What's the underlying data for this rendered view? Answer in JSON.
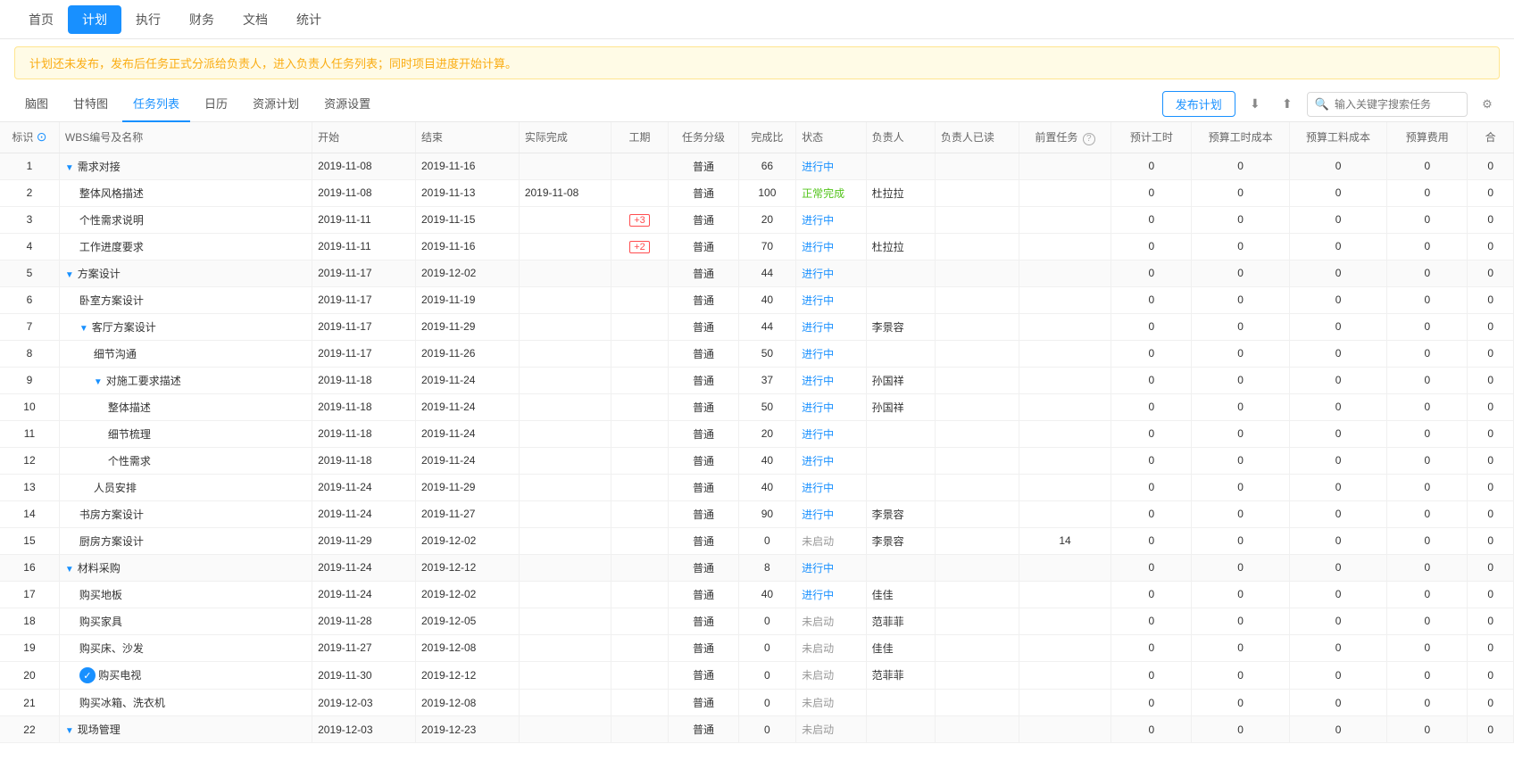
{
  "topNav": {
    "items": [
      {
        "label": "首页",
        "active": false
      },
      {
        "label": "计划",
        "active": true
      },
      {
        "label": "执行",
        "active": false
      },
      {
        "label": "财务",
        "active": false
      },
      {
        "label": "文档",
        "active": false
      },
      {
        "label": "统计",
        "active": false
      }
    ]
  },
  "alert": {
    "text": "计划还未发布，发布后任务正式分派给负责人，进入负责人任务列表；同时项目进度开始计算。"
  },
  "subNav": {
    "items": [
      {
        "label": "脑图",
        "active": false
      },
      {
        "label": "甘特图",
        "active": false
      },
      {
        "label": "任务列表",
        "active": true
      },
      {
        "label": "日历",
        "active": false
      },
      {
        "label": "资源计划",
        "active": false
      },
      {
        "label": "资源设置",
        "active": false
      }
    ],
    "publishBtn": "发布计划",
    "searchPlaceholder": "输入关键字搜索任务"
  },
  "table": {
    "columns": [
      "标识",
      "WBS编号及名称",
      "开始",
      "结束",
      "实际完成",
      "工期",
      "任务分级",
      "完成比",
      "状态",
      "负责人",
      "负责人已读",
      "前置任务",
      "预计工时",
      "预算工时成本",
      "预算工料成本",
      "预算费用",
      "合"
    ],
    "rows": [
      {
        "id": "1",
        "level": 0,
        "isGroup": true,
        "expand": true,
        "name": "需求对接",
        "start": "2019-11-08",
        "end": "2019-11-16",
        "actual": "",
        "work": "",
        "priority": "普通",
        "progress": "66",
        "status": "进行中",
        "assignee": "",
        "read": "",
        "predecessor": "",
        "estTime": "0",
        "estTimeCost": "0",
        "estLaborCost": "0",
        "estExpense": "0"
      },
      {
        "id": "2",
        "level": 1,
        "isGroup": false,
        "name": "整体风格描述",
        "start": "2019-11-08",
        "end": "2019-11-13",
        "actual": "2019-11-08",
        "work": "",
        "priority": "普通",
        "progress": "100",
        "status": "正常完成",
        "assignee": "杜拉拉",
        "read": "",
        "predecessor": "",
        "estTime": "0",
        "estTimeCost": "0",
        "estLaborCost": "0",
        "estExpense": "0"
      },
      {
        "id": "3",
        "level": 1,
        "isGroup": false,
        "name": "个性需求说明",
        "start": "2019-11-11",
        "end": "2019-11-15",
        "actual": "",
        "work": "+3",
        "priority": "普通",
        "progress": "20",
        "status": "进行中",
        "assignee": "",
        "read": "",
        "predecessor": "",
        "estTime": "0",
        "estTimeCost": "0",
        "estLaborCost": "0",
        "estExpense": "0"
      },
      {
        "id": "4",
        "level": 1,
        "isGroup": false,
        "name": "工作进度要求",
        "start": "2019-11-11",
        "end": "2019-11-16",
        "actual": "",
        "work": "+2",
        "priority": "普通",
        "progress": "70",
        "status": "进行中",
        "assignee": "杜拉拉",
        "read": "",
        "predecessor": "",
        "estTime": "0",
        "estTimeCost": "0",
        "estLaborCost": "0",
        "estExpense": "0"
      },
      {
        "id": "5",
        "level": 0,
        "isGroup": true,
        "expand": true,
        "name": "方案设计",
        "start": "2019-11-17",
        "end": "2019-12-02",
        "actual": "",
        "work": "",
        "priority": "普通",
        "progress": "44",
        "status": "进行中",
        "assignee": "",
        "read": "",
        "predecessor": "",
        "estTime": "0",
        "estTimeCost": "0",
        "estLaborCost": "0",
        "estExpense": "0"
      },
      {
        "id": "6",
        "level": 1,
        "isGroup": false,
        "name": "卧室方案设计",
        "start": "2019-11-17",
        "end": "2019-11-19",
        "actual": "",
        "work": "",
        "priority": "普通",
        "progress": "40",
        "status": "进行中",
        "assignee": "",
        "read": "",
        "predecessor": "",
        "estTime": "0",
        "estTimeCost": "0",
        "estLaborCost": "0",
        "estExpense": "0"
      },
      {
        "id": "7",
        "level": 1,
        "isGroup": true,
        "expand": true,
        "name": "客厅方案设计",
        "start": "2019-11-17",
        "end": "2019-11-29",
        "actual": "",
        "work": "",
        "priority": "普通",
        "progress": "44",
        "status": "进行中",
        "assignee": "李景容",
        "read": "",
        "predecessor": "",
        "estTime": "0",
        "estTimeCost": "0",
        "estLaborCost": "0",
        "estExpense": "0"
      },
      {
        "id": "8",
        "level": 2,
        "isGroup": false,
        "name": "细节沟通",
        "start": "2019-11-17",
        "end": "2019-11-26",
        "actual": "",
        "work": "",
        "priority": "普通",
        "progress": "50",
        "status": "进行中",
        "assignee": "",
        "read": "",
        "predecessor": "",
        "estTime": "0",
        "estTimeCost": "0",
        "estLaborCost": "0",
        "estExpense": "0"
      },
      {
        "id": "9",
        "level": 2,
        "isGroup": true,
        "expand": true,
        "name": "对施工要求描述",
        "start": "2019-11-18",
        "end": "2019-11-24",
        "actual": "",
        "work": "",
        "priority": "普通",
        "progress": "37",
        "status": "进行中",
        "assignee": "孙国祥",
        "read": "",
        "predecessor": "",
        "estTime": "0",
        "estTimeCost": "0",
        "estLaborCost": "0",
        "estExpense": "0"
      },
      {
        "id": "10",
        "level": 3,
        "isGroup": false,
        "name": "整体描述",
        "start": "2019-11-18",
        "end": "2019-11-24",
        "actual": "",
        "work": "",
        "priority": "普通",
        "progress": "50",
        "status": "进行中",
        "assignee": "孙国祥",
        "read": "",
        "predecessor": "",
        "estTime": "0",
        "estTimeCost": "0",
        "estLaborCost": "0",
        "estExpense": "0"
      },
      {
        "id": "11",
        "level": 3,
        "isGroup": false,
        "name": "细节梳理",
        "start": "2019-11-18",
        "end": "2019-11-24",
        "actual": "",
        "work": "",
        "priority": "普通",
        "progress": "20",
        "status": "进行中",
        "assignee": "",
        "read": "",
        "predecessor": "",
        "estTime": "0",
        "estTimeCost": "0",
        "estLaborCost": "0",
        "estExpense": "0"
      },
      {
        "id": "12",
        "level": 3,
        "isGroup": false,
        "name": "个性需求",
        "start": "2019-11-18",
        "end": "2019-11-24",
        "actual": "",
        "work": "",
        "priority": "普通",
        "progress": "40",
        "status": "进行中",
        "assignee": "",
        "read": "",
        "predecessor": "",
        "estTime": "0",
        "estTimeCost": "0",
        "estLaborCost": "0",
        "estExpense": "0"
      },
      {
        "id": "13",
        "level": 2,
        "isGroup": false,
        "name": "人员安排",
        "start": "2019-11-24",
        "end": "2019-11-29",
        "actual": "",
        "work": "",
        "priority": "普通",
        "progress": "40",
        "status": "进行中",
        "assignee": "",
        "read": "",
        "predecessor": "",
        "estTime": "0",
        "estTimeCost": "0",
        "estLaborCost": "0",
        "estExpense": "0"
      },
      {
        "id": "14",
        "level": 1,
        "isGroup": false,
        "name": "书房方案设计",
        "start": "2019-11-24",
        "end": "2019-11-27",
        "actual": "",
        "work": "",
        "priority": "普通",
        "progress": "90",
        "status": "进行中",
        "assignee": "李景容",
        "read": "",
        "predecessor": "",
        "estTime": "0",
        "estTimeCost": "0",
        "estLaborCost": "0",
        "estExpense": "0"
      },
      {
        "id": "15",
        "level": 1,
        "isGroup": false,
        "name": "厨房方案设计",
        "start": "2019-11-29",
        "end": "2019-12-02",
        "actual": "",
        "work": "",
        "priority": "普通",
        "progress": "0",
        "status": "未启动",
        "assignee": "李景容",
        "read": "",
        "predecessor": "14",
        "estTime": "0",
        "estTimeCost": "0",
        "estLaborCost": "0",
        "estExpense": "0"
      },
      {
        "id": "16",
        "level": 0,
        "isGroup": true,
        "expand": true,
        "name": "材料采购",
        "start": "2019-11-24",
        "end": "2019-12-12",
        "actual": "",
        "work": "",
        "priority": "普通",
        "progress": "8",
        "status": "进行中",
        "assignee": "",
        "read": "",
        "predecessor": "",
        "estTime": "0",
        "estTimeCost": "0",
        "estLaborCost": "0",
        "estExpense": "0"
      },
      {
        "id": "17",
        "level": 1,
        "isGroup": false,
        "name": "购买地板",
        "start": "2019-11-24",
        "end": "2019-12-02",
        "actual": "",
        "work": "",
        "priority": "普通",
        "progress": "40",
        "status": "进行中",
        "assignee": "佳佳",
        "read": "",
        "predecessor": "",
        "estTime": "0",
        "estTimeCost": "0",
        "estLaborCost": "0",
        "estExpense": "0"
      },
      {
        "id": "18",
        "level": 1,
        "isGroup": false,
        "name": "购买家具",
        "start": "2019-11-28",
        "end": "2019-12-05",
        "actual": "",
        "work": "",
        "priority": "普通",
        "progress": "0",
        "status": "未启动",
        "assignee": "范菲菲",
        "read": "",
        "predecessor": "",
        "estTime": "0",
        "estTimeCost": "0",
        "estLaborCost": "0",
        "estExpense": "0"
      },
      {
        "id": "19",
        "level": 1,
        "isGroup": false,
        "name": "购买床、沙发",
        "start": "2019-11-27",
        "end": "2019-12-08",
        "actual": "",
        "work": "",
        "priority": "普通",
        "progress": "0",
        "status": "未启动",
        "assignee": "佳佳",
        "read": "",
        "predecessor": "",
        "estTime": "0",
        "estTimeCost": "0",
        "estLaborCost": "0",
        "estExpense": "0"
      },
      {
        "id": "20",
        "level": 1,
        "isGroup": false,
        "hasCheck": true,
        "name": "购买电视",
        "start": "2019-11-30",
        "end": "2019-12-12",
        "actual": "",
        "work": "",
        "priority": "普通",
        "progress": "0",
        "status": "未启动",
        "assignee": "范菲菲",
        "read": "",
        "predecessor": "",
        "estTime": "0",
        "estTimeCost": "0",
        "estLaborCost": "0",
        "estExpense": "0"
      },
      {
        "id": "21",
        "level": 1,
        "isGroup": false,
        "name": "购买冰箱、洗衣机",
        "start": "2019-12-03",
        "end": "2019-12-08",
        "actual": "",
        "work": "",
        "priority": "普通",
        "progress": "0",
        "status": "未启动",
        "assignee": "",
        "read": "",
        "predecessor": "",
        "estTime": "0",
        "estTimeCost": "0",
        "estLaborCost": "0",
        "estExpense": "0"
      },
      {
        "id": "22",
        "level": 0,
        "isGroup": true,
        "expand": true,
        "name": "现场管理",
        "start": "2019-12-03",
        "end": "2019-12-23",
        "actual": "",
        "work": "",
        "priority": "普通",
        "progress": "0",
        "status": "未启动",
        "assignee": "",
        "read": "",
        "predecessor": "",
        "estTime": "0",
        "estTimeCost": "0",
        "estLaborCost": "0",
        "estExpense": "0"
      }
    ]
  }
}
